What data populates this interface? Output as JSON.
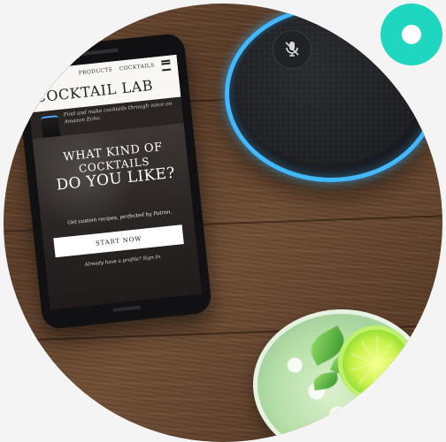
{
  "phone_screen": {
    "nav": {
      "products": "PRODUCTS",
      "cocktails": "COCKTAILS"
    },
    "brand": "COCKTAIL LAB",
    "blurb": "Find and make cocktails through voice on Amazon Echo.",
    "headline": {
      "line1": "WHAT KIND OF",
      "line2": "COCKTAILS",
      "line3": "DO YOU LIKE?"
    },
    "subtitle": "Get custom recipes, perfected by Patrón.",
    "start_button": "START NOW",
    "profile_link": "Already have a profile? Sign In"
  },
  "icons": {
    "menu": "hamburger-menu-icon",
    "mic": "microphone-icon",
    "logo": "circle-logo-icon"
  },
  "colors": {
    "logo_teal": "#1fd6c1",
    "echo_blue": "#42b8ff",
    "wood_brown": "#6b4a32",
    "lime_green": "#c9f24a"
  }
}
